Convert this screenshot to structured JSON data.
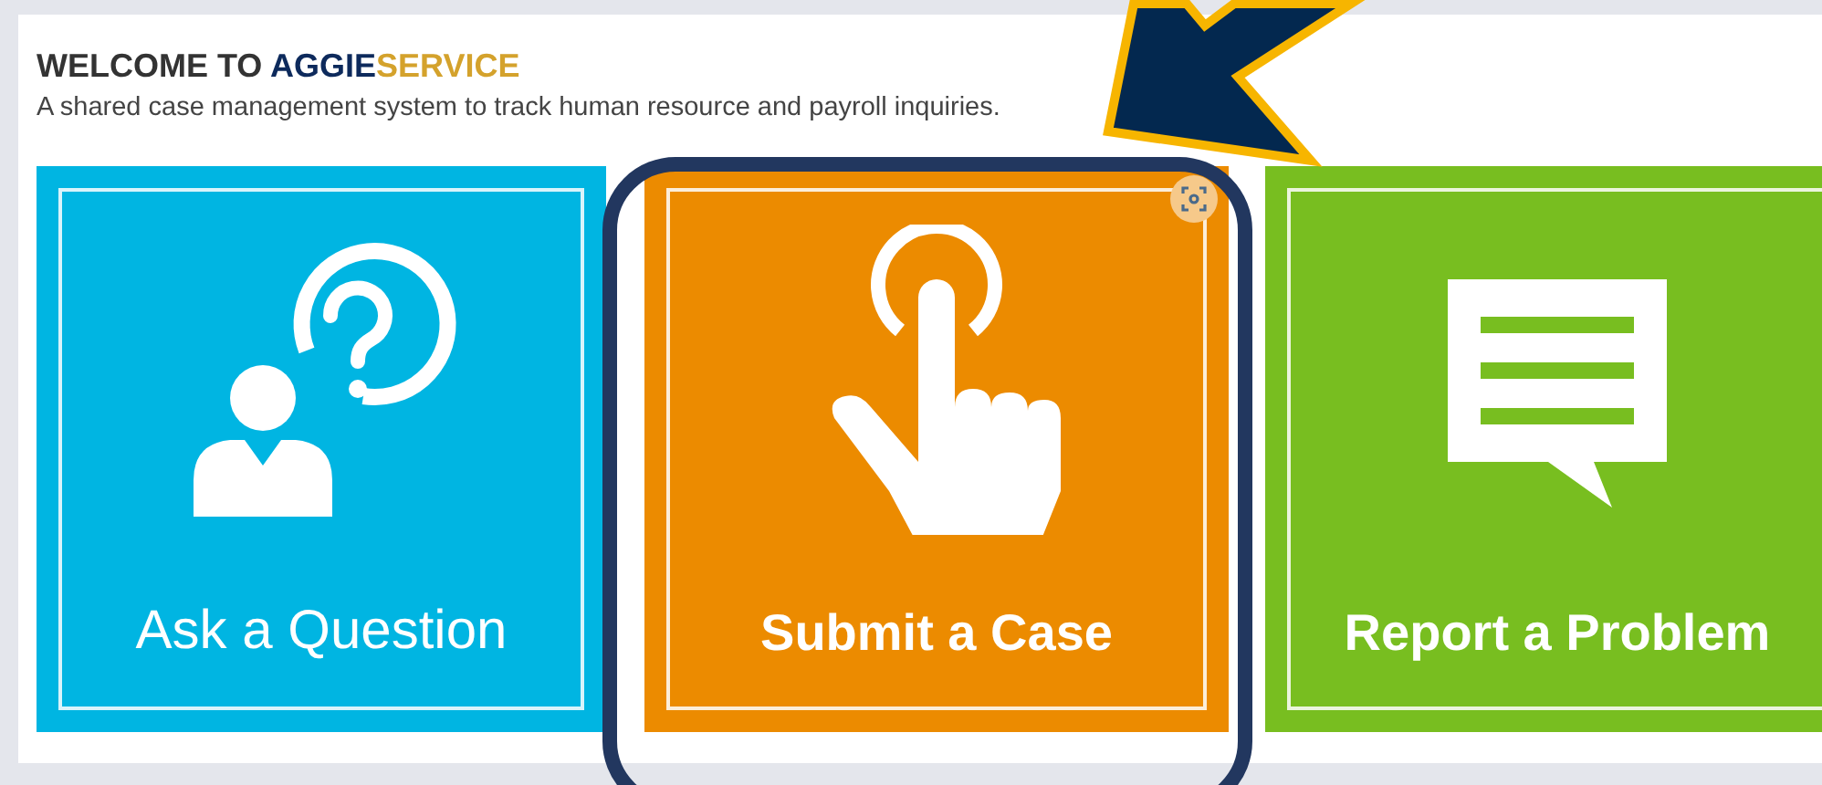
{
  "header": {
    "title_prefix": "WELCOME TO ",
    "brand_primary": "AGGIE",
    "brand_accent": "SERVICE",
    "subtitle": "A shared case management system to track human resource and payroll inquiries."
  },
  "tiles": [
    {
      "label": "Ask a Question",
      "kind": "question",
      "color": "#00b5e2",
      "bold": false
    },
    {
      "label": "Submit a Case",
      "kind": "touch",
      "color": "#ec8b00",
      "bold": true
    },
    {
      "label": "Report a Problem",
      "kind": "comment",
      "color": "#78be20",
      "bold": true
    }
  ],
  "annotations": {
    "highlight_frame": true,
    "pointer_arrow": true
  }
}
